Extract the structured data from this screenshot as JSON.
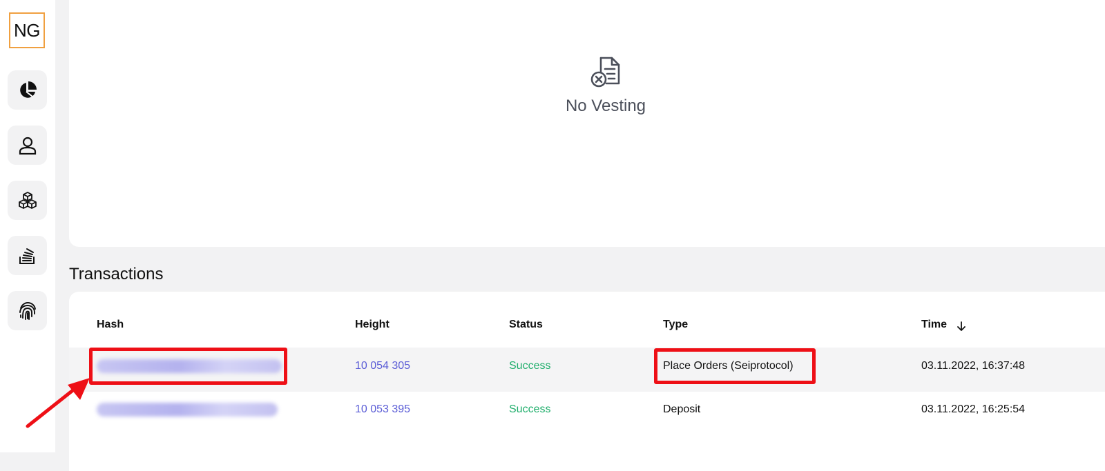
{
  "logo": {
    "text": "NG",
    "border_color": "#f0a040"
  },
  "sidebar": {
    "items": [
      {
        "icon": "pie-chart-icon"
      },
      {
        "icon": "user-icon"
      },
      {
        "icon": "blocks-icon"
      },
      {
        "icon": "stack-icon"
      },
      {
        "icon": "fingerprint-icon"
      }
    ]
  },
  "vesting": {
    "empty_text": "No Vesting",
    "icon": "document-x-icon"
  },
  "transactions": {
    "title": "Transactions",
    "columns": {
      "hash": "Hash",
      "height": "Height",
      "status": "Status",
      "type": "Type",
      "time": "Time"
    },
    "sort_icon": "arrow-down-icon",
    "rows": [
      {
        "hash": "",
        "height": "10 054 305",
        "status": "Success",
        "type": "Place Orders (Seiprotocol)",
        "time": "03.11.2022, 16:37:48"
      },
      {
        "hash": "",
        "height": "10 053 395",
        "status": "Success",
        "type": "Deposit",
        "time": "03.11.2022, 16:25:54"
      }
    ]
  },
  "colors": {
    "link": "#5a5cd6",
    "success": "#1fae6b",
    "highlight": "#ee0f16"
  }
}
